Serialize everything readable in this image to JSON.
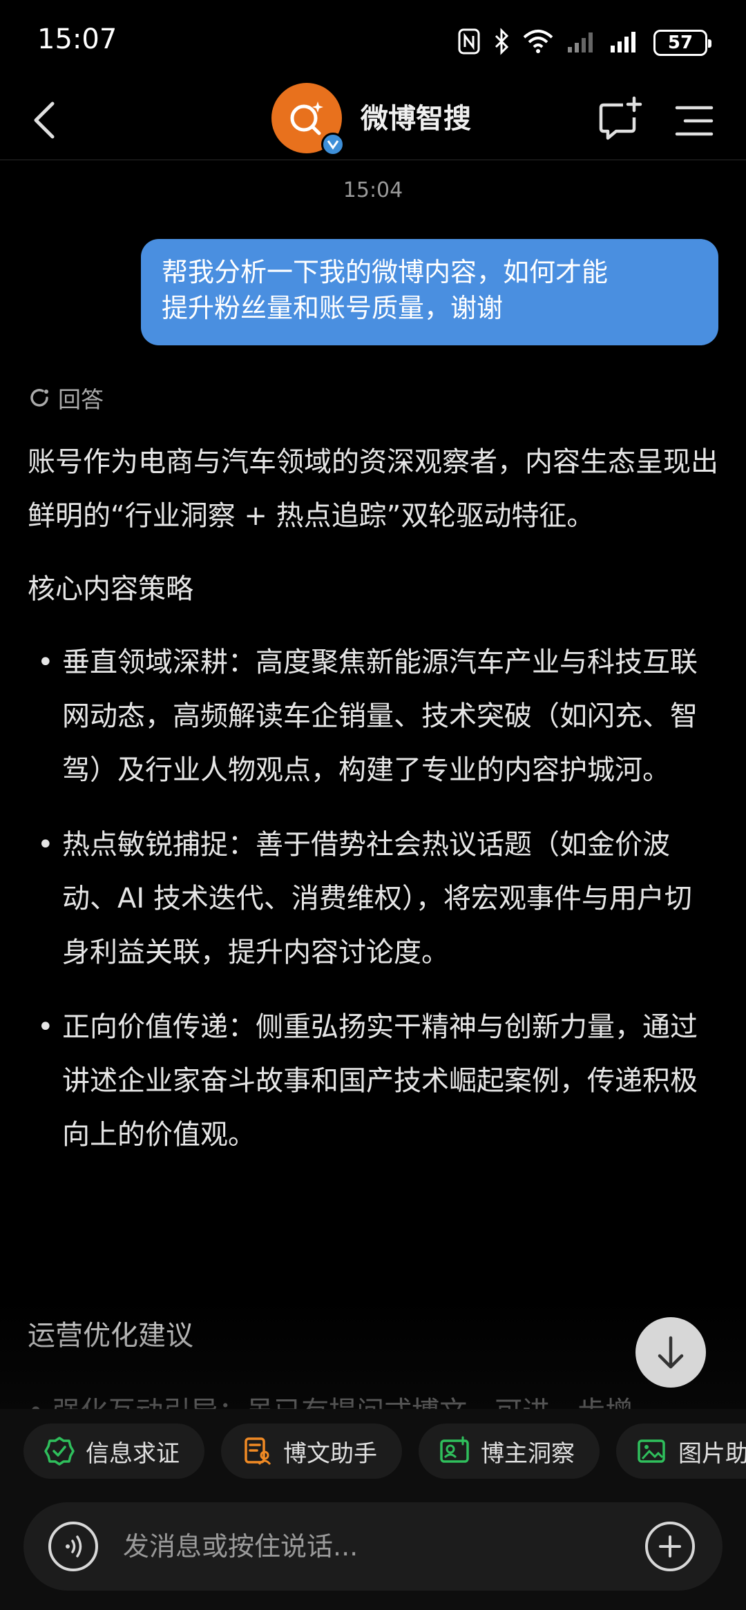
{
  "status_bar": {
    "time": "15:07",
    "battery": "57"
  },
  "header": {
    "title": "微博智搜"
  },
  "chat": {
    "timestamp": "15:04",
    "user_message_line1": "帮我分析一下我的微博内容，如何才能",
    "user_message_line2": "提升粉丝量和账号质量，谢谢",
    "answer_label": "回答",
    "intro": "账号作为电商与汽车领域的资深观察者，内容生态呈现出鲜明的“行业洞察 + 热点追踪”双轮驱动特征。",
    "section1_title": "核心内容策略",
    "bullets": [
      "垂直领域深耕：高度聚焦新能源汽车产业与科技互联网动态，高频解读车企销量、技术突破（如闪充、智驾）及行业人物观点，构建了专业的内容护城河。",
      "热点敏锐捕捉：善于借势社会热议话题（如金价波动、AI 技术迭代、消费维权），将宏观事件与用户切身利益关联，提升内容讨论度。",
      "正向价值传递：侧重弘扬实干精神与创新力量，通过讲述企业家奋斗故事和国产技术崛起案例，传递积极向上的价值观。"
    ],
    "section2_title": "运营优化建议",
    "cut_line": "• 强化互动引导：虽已有提问式博文，可进一步增"
  },
  "chips": [
    {
      "label": "信息求证",
      "icon": "shield-check-icon",
      "color": "#2fbf5c"
    },
    {
      "label": "博文助手",
      "icon": "document-person-icon",
      "color": "#f08a24"
    },
    {
      "label": "博主洞察",
      "icon": "id-card-icon",
      "color": "#2fbf5c"
    },
    {
      "label": "图片助",
      "icon": "image-icon",
      "color": "#2fbf5c"
    }
  ],
  "input": {
    "placeholder": "发消息或按住说话..."
  },
  "colors": {
    "bubble": "#4a8fe0",
    "avatar": "#e8711d",
    "verified": "#3e8fd8"
  }
}
